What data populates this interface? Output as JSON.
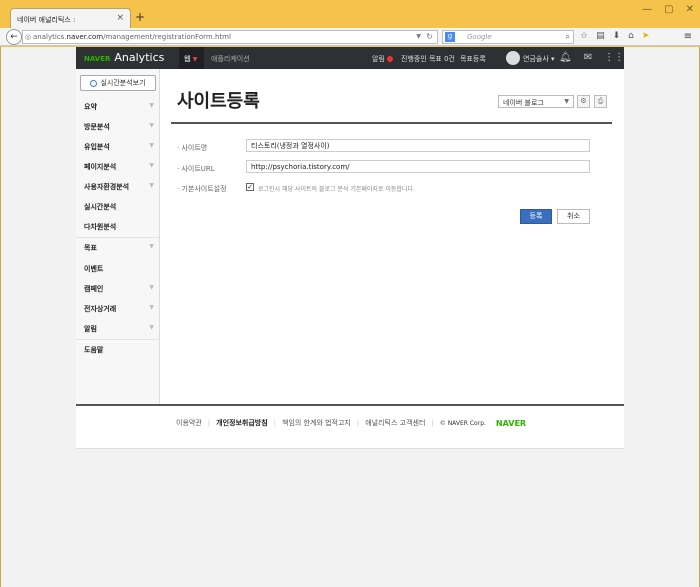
{
  "browser": {
    "tab_title": "네이버 애널리틱스 :",
    "tab_close": "×",
    "new_tab": "+",
    "url_prefix": "analytics.",
    "url_domain": "naver.com",
    "url_path": "/management/registrationForm.html",
    "search_placeholder": "Google",
    "search_engine_letter": "g"
  },
  "gnb": {
    "brand_naver": "NAVER",
    "brand_product": "Analytics",
    "tab_web": "웹",
    "tab_apps": "애플리케이션",
    "alarm": "알림",
    "goal_status": "진행중인 목표 0건",
    "goal_register": "목표등록",
    "user": "연금술사"
  },
  "sidebar": {
    "realtime_button": "실시간분석보기",
    "items": [
      {
        "label": "요약",
        "chevron": true
      },
      {
        "label": "방문분석",
        "chevron": true
      },
      {
        "label": "유입분석",
        "chevron": true
      },
      {
        "label": "페이지분석",
        "chevron": true
      },
      {
        "label": "사용자환경분석",
        "chevron": true
      },
      {
        "label": "실시간분석",
        "chevron": false
      },
      {
        "label": "다차원분석",
        "chevron": false
      },
      {
        "label": "목표",
        "chevron": true
      },
      {
        "label": "이벤트",
        "chevron": false
      },
      {
        "label": "캠페인",
        "chevron": true
      },
      {
        "label": "전자상거래",
        "chevron": true
      },
      {
        "label": "알림",
        "chevron": true
      },
      {
        "label": "도움말",
        "chevron": false
      }
    ]
  },
  "main": {
    "title": "사이트등록",
    "site_select": "네이버 블로그",
    "form": {
      "site_name_label": "· 사이트명",
      "site_name_value": "티스토리(냉정과 열정사이)",
      "site_url_label": "· 사이트URL",
      "site_url_value": "http://psychoria.tistory.com/",
      "default_label": "· 기본사이트설정",
      "default_checked": true,
      "default_text": "로그인시 해당 사이트의 블로그 분석 기본페이지로 이동합니다."
    },
    "register_button": "등록",
    "cancel_button": "취소"
  },
  "footer": {
    "terms": "이용약관",
    "privacy": "개인정보취급방침",
    "disclaimer": "책임의 한계와 법적고지",
    "support": "애널리틱스 고객센터",
    "copyright": "© NAVER Corp.",
    "logo": "NAVER"
  }
}
